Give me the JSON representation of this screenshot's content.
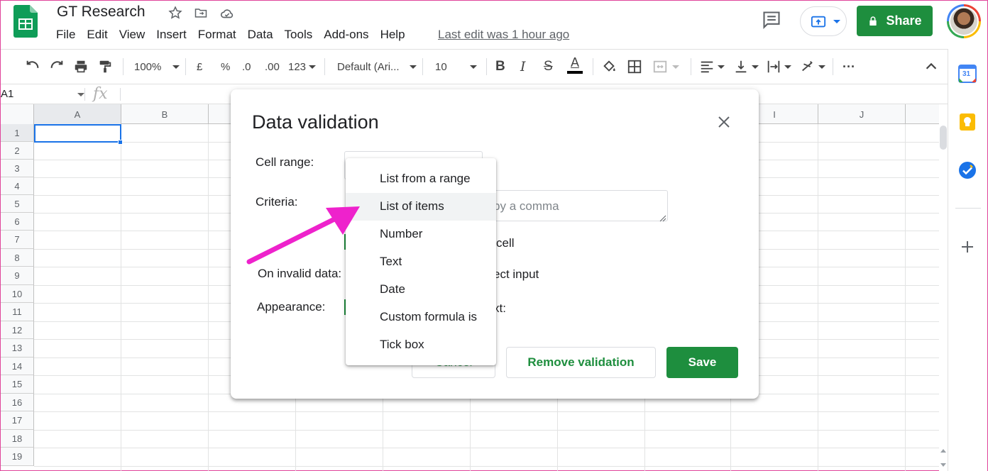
{
  "app": {
    "doc_title": "GT Research",
    "menu": [
      "File",
      "Edit",
      "View",
      "Insert",
      "Format",
      "Data",
      "Tools",
      "Add-ons",
      "Help"
    ],
    "last_edit": "Last edit was 1 hour ago",
    "share_label": "Share"
  },
  "toolbar": {
    "zoom": "100%",
    "currency": "£",
    "percent": "%",
    "decrease_decimals": ".0",
    "increase_decimals": ".00",
    "more_formats": "123",
    "font": "Default (Ari...",
    "font_size": "10",
    "bold": "B",
    "italic": "I",
    "strikethrough": "S",
    "text_color": "A",
    "more": "···"
  },
  "formula_bar": {
    "cell_ref": "A1",
    "fx": "fx"
  },
  "grid": {
    "columns": [
      "A",
      "B",
      "",
      "",
      "",
      "",
      "",
      "",
      "I",
      "J"
    ],
    "rows": [
      "1",
      "2",
      "3",
      "4",
      "5",
      "6",
      "7",
      "8",
      "9",
      "10",
      "11",
      "12",
      "13",
      "14",
      "15",
      "16",
      "17",
      "18",
      "19"
    ]
  },
  "dialog": {
    "title": "Data validation",
    "cell_range_label": "Cell range:",
    "criteria_label": "Criteria:",
    "criteria_placeholder": "Enter items separated by a comma",
    "show_dropdown_fragment": "cell",
    "on_invalid_label": "On invalid data:",
    "on_invalid_fragment": "ect input",
    "appearance_label": "Appearance:",
    "appearance_fragment": "xt:",
    "cancel_label": "Cancel",
    "remove_label": "Remove validation",
    "save_label": "Save"
  },
  "criteria_menu": {
    "options": [
      "List from a range",
      "List of items",
      "Number",
      "Text",
      "Date",
      "Custom formula is",
      "Tick box"
    ],
    "highlighted": "List of items"
  },
  "side_panel": {
    "calendar_day": "31"
  },
  "colors": {
    "accent_green": "#1e8e3e",
    "selection_blue": "#1a73e8",
    "annotation_arrow": "#ee22cc"
  }
}
